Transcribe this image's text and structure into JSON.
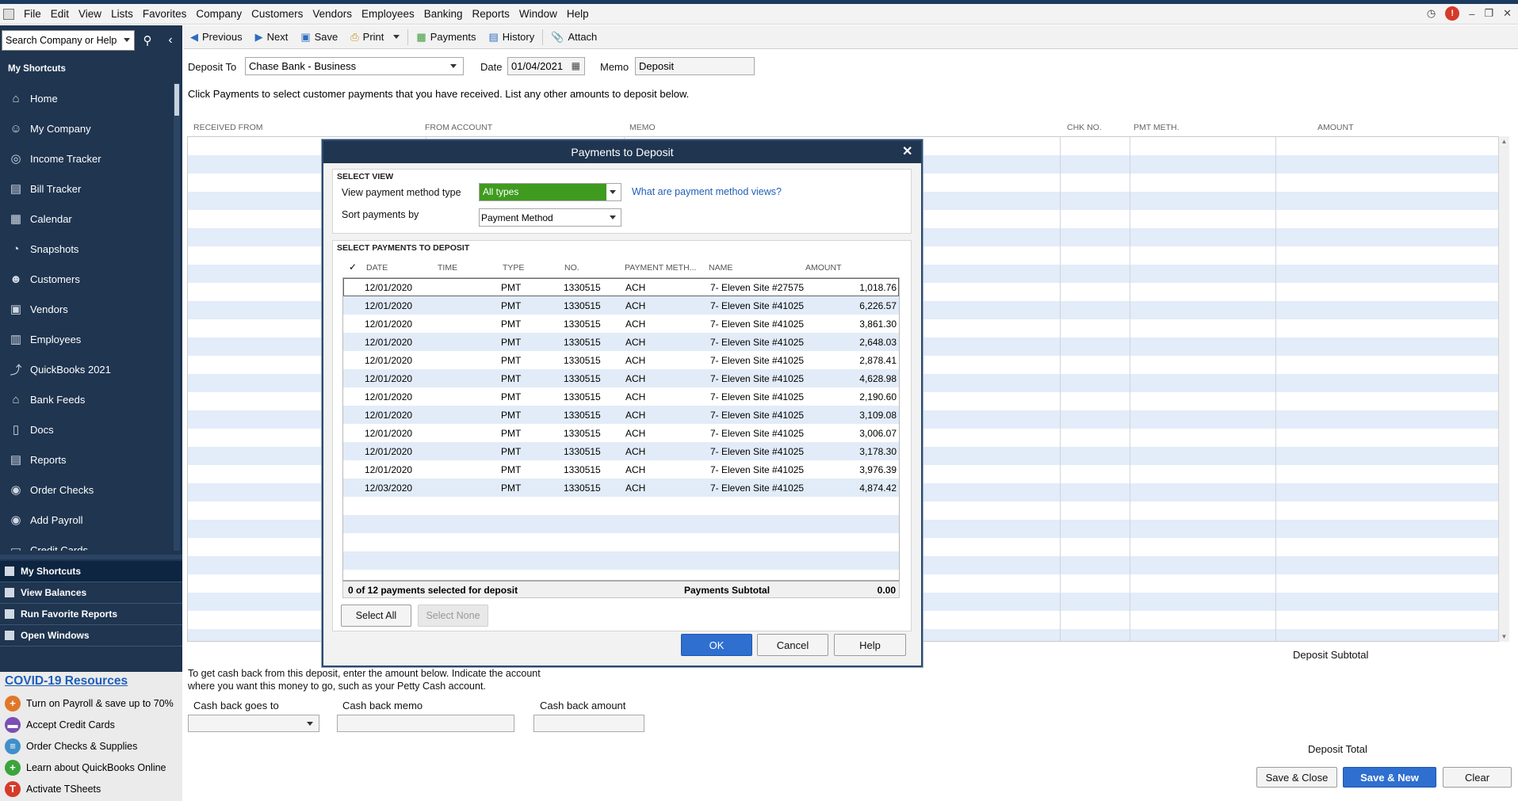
{
  "menu": [
    "File",
    "Edit",
    "View",
    "Lists",
    "Favorites",
    "Company",
    "Customers",
    "Vendors",
    "Employees",
    "Banking",
    "Reports",
    "Window",
    "Help"
  ],
  "alert_count": "!",
  "search": {
    "placeholder": "Search Company or Help"
  },
  "sidebar": {
    "header": "My Shortcuts",
    "items": [
      {
        "label": "Home",
        "icon": "home-icon"
      },
      {
        "label": "My Company",
        "icon": "company-icon"
      },
      {
        "label": "Income Tracker",
        "icon": "income-tracker-icon"
      },
      {
        "label": "Bill Tracker",
        "icon": "bill-tracker-icon"
      },
      {
        "label": "Calendar",
        "icon": "calendar-icon"
      },
      {
        "label": "Snapshots",
        "icon": "snapshots-icon"
      },
      {
        "label": "Customers",
        "icon": "customers-icon"
      },
      {
        "label": "Vendors",
        "icon": "vendors-icon"
      },
      {
        "label": "Employees",
        "icon": "employees-icon"
      },
      {
        "label": "QuickBooks 2021",
        "icon": "quickbooks-icon"
      },
      {
        "label": "Bank Feeds",
        "icon": "bank-icon"
      },
      {
        "label": "Docs",
        "icon": "docs-icon"
      },
      {
        "label": "Reports",
        "icon": "reports-icon"
      },
      {
        "label": "Order Checks",
        "icon": "order-checks-icon"
      },
      {
        "label": "Add Payroll",
        "icon": "payroll-icon"
      },
      {
        "label": "Credit Cards",
        "icon": "credit-cards-icon"
      }
    ],
    "sections": [
      "My Shortcuts",
      "View Balances",
      "Run Favorite Reports",
      "Open Windows"
    ],
    "covid": {
      "title": "COVID-19 Resources",
      "items": [
        {
          "label": "Turn on Payroll & save up to 70%",
          "color": "#e0772a",
          "glyph": "+"
        },
        {
          "label": "Accept Credit Cards",
          "color": "#7b4fb5",
          "glyph": "▬"
        },
        {
          "label": "Order Checks & Supplies",
          "color": "#3f8fc9",
          "glyph": "≡"
        },
        {
          "label": "Learn about QuickBooks Online",
          "color": "#3aa53a",
          "glyph": "+"
        },
        {
          "label": "Activate TSheets",
          "color": "#d63a2a",
          "glyph": "T"
        }
      ]
    }
  },
  "toolbar": {
    "previous": "Previous",
    "next": "Next",
    "save": "Save",
    "print": "Print",
    "payments": "Payments",
    "history": "History",
    "attach": "Attach"
  },
  "form": {
    "deposit_to_label": "Deposit To",
    "deposit_to_value": "Chase Bank - Business",
    "date_label": "Date",
    "date_value": "01/04/2021",
    "memo_label": "Memo",
    "memo_value": "Deposit",
    "instructions": "Click Payments to select customer payments that you have received. List any other amounts to deposit below."
  },
  "grid_headers": [
    "RECEIVED FROM",
    "FROM ACCOUNT",
    "MEMO",
    "CHK NO.",
    "PMT METH.",
    "AMOUNT"
  ],
  "bottom": {
    "cashback_line1": "To get cash back from this deposit, enter the amount below.  Indicate the account",
    "cashback_line2": "where you want this money to go, such as your Petty Cash account.",
    "goes_to_label": "Cash back goes to",
    "memo_label": "Cash back memo",
    "amount_label": "Cash back amount",
    "subtotal_label": "Deposit Subtotal",
    "total_label": "Deposit Total",
    "save_close": "Save & Close",
    "save_new": "Save & New",
    "clear": "Clear"
  },
  "dialog": {
    "title": "Payments to Deposit",
    "select_view_title": "SELECT VIEW",
    "view_type_label": "View payment method type",
    "view_type_value": "All types",
    "help_link": "What are payment method views?",
    "sort_label": "Sort payments by",
    "sort_value": "Payment Method",
    "select_payments_title": "SELECT PAYMENTS TO DEPOSIT",
    "columns": [
      "✓",
      "DATE",
      "TIME",
      "TYPE",
      "NO.",
      "PAYMENT METH...",
      "NAME",
      "AMOUNT"
    ],
    "rows": [
      {
        "date": "12/01/2020",
        "type": "PMT",
        "no": "1330515",
        "method": "ACH",
        "name": "7- Eleven Site #27575",
        "amount": "1,018.76"
      },
      {
        "date": "12/01/2020",
        "type": "PMT",
        "no": "1330515",
        "method": "ACH",
        "name": "7- Eleven Site #41025",
        "amount": "6,226.57"
      },
      {
        "date": "12/01/2020",
        "type": "PMT",
        "no": "1330515",
        "method": "ACH",
        "name": "7- Eleven Site #41025",
        "amount": "3,861.30"
      },
      {
        "date": "12/01/2020",
        "type": "PMT",
        "no": "1330515",
        "method": "ACH",
        "name": "7- Eleven Site #41025",
        "amount": "2,648.03"
      },
      {
        "date": "12/01/2020",
        "type": "PMT",
        "no": "1330515",
        "method": "ACH",
        "name": "7- Eleven Site #41025",
        "amount": "2,878.41"
      },
      {
        "date": "12/01/2020",
        "type": "PMT",
        "no": "1330515",
        "method": "ACH",
        "name": "7- Eleven Site #41025",
        "amount": "4,628.98"
      },
      {
        "date": "12/01/2020",
        "type": "PMT",
        "no": "1330515",
        "method": "ACH",
        "name": "7- Eleven Site #41025",
        "amount": "2,190.60"
      },
      {
        "date": "12/01/2020",
        "type": "PMT",
        "no": "1330515",
        "method": "ACH",
        "name": "7- Eleven Site #41025",
        "amount": "3,109.08"
      },
      {
        "date": "12/01/2020",
        "type": "PMT",
        "no": "1330515",
        "method": "ACH",
        "name": "7- Eleven Site #41025",
        "amount": "3,006.07"
      },
      {
        "date": "12/01/2020",
        "type": "PMT",
        "no": "1330515",
        "method": "ACH",
        "name": "7- Eleven Site #41025",
        "amount": "3,178.30"
      },
      {
        "date": "12/01/2020",
        "type": "PMT",
        "no": "1330515",
        "method": "ACH",
        "name": "7- Eleven Site #41025",
        "amount": "3,976.39"
      },
      {
        "date": "12/03/2020",
        "type": "PMT",
        "no": "1330515",
        "method": "ACH",
        "name": "7- Eleven Site #41025",
        "amount": "4,874.42"
      }
    ],
    "selected_summary": "0 of 12 payments selected for deposit",
    "subtotal_label": "Payments Subtotal",
    "subtotal_value": "0.00",
    "select_all": "Select All",
    "select_none": "Select None",
    "ok": "OK",
    "cancel": "Cancel",
    "help": "Help"
  }
}
